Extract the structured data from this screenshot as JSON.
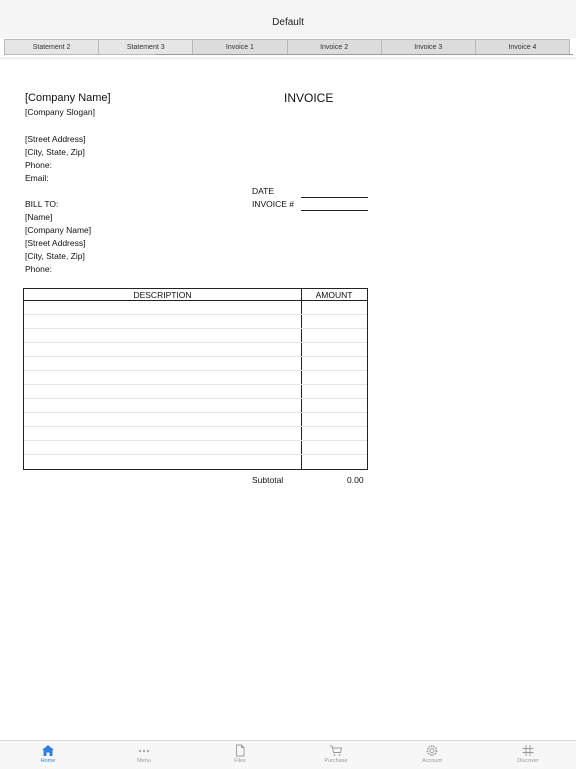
{
  "window": {
    "title": "Default"
  },
  "tabs": [
    {
      "label": "Statement 2"
    },
    {
      "label": "Statement 3"
    },
    {
      "label": "Invoice 1"
    },
    {
      "label": "Invoice 2"
    },
    {
      "label": "Invoice 3"
    },
    {
      "label": "Invoice 4"
    }
  ],
  "invoice": {
    "company_name": "[Company Name]",
    "company_slogan": "[Company Slogan]",
    "title": "INVOICE",
    "street": "[Street Address]",
    "city": "[City, State,  Zip]",
    "phone": "Phone:",
    "email": "Email:",
    "date_label": "DATE",
    "invoice_no_label": "INVOICE #",
    "bill_to": {
      "label": "BILL TO:",
      "name": "[Name]",
      "company": "[Company Name]",
      "street": "[Street Address]",
      "city": "[City, State,  Zip]",
      "phone": "Phone:"
    },
    "table": {
      "col_description": "DESCRIPTION",
      "col_amount": "AMOUNT"
    },
    "subtotal_label": "Subtotal",
    "subtotal_value": "0.00"
  },
  "bottom_nav": [
    {
      "label": "Home",
      "icon": "home-icon",
      "active": true
    },
    {
      "label": "Menu",
      "icon": "more-dots-icon"
    },
    {
      "label": "Files",
      "icon": "file-icon"
    },
    {
      "label": "Purchase",
      "icon": "cart-icon"
    },
    {
      "label": "Account",
      "icon": "gear-icon"
    },
    {
      "label": "Discover",
      "icon": "hashtag-icon"
    }
  ],
  "colors": {
    "accent": "#2f7fe0"
  }
}
